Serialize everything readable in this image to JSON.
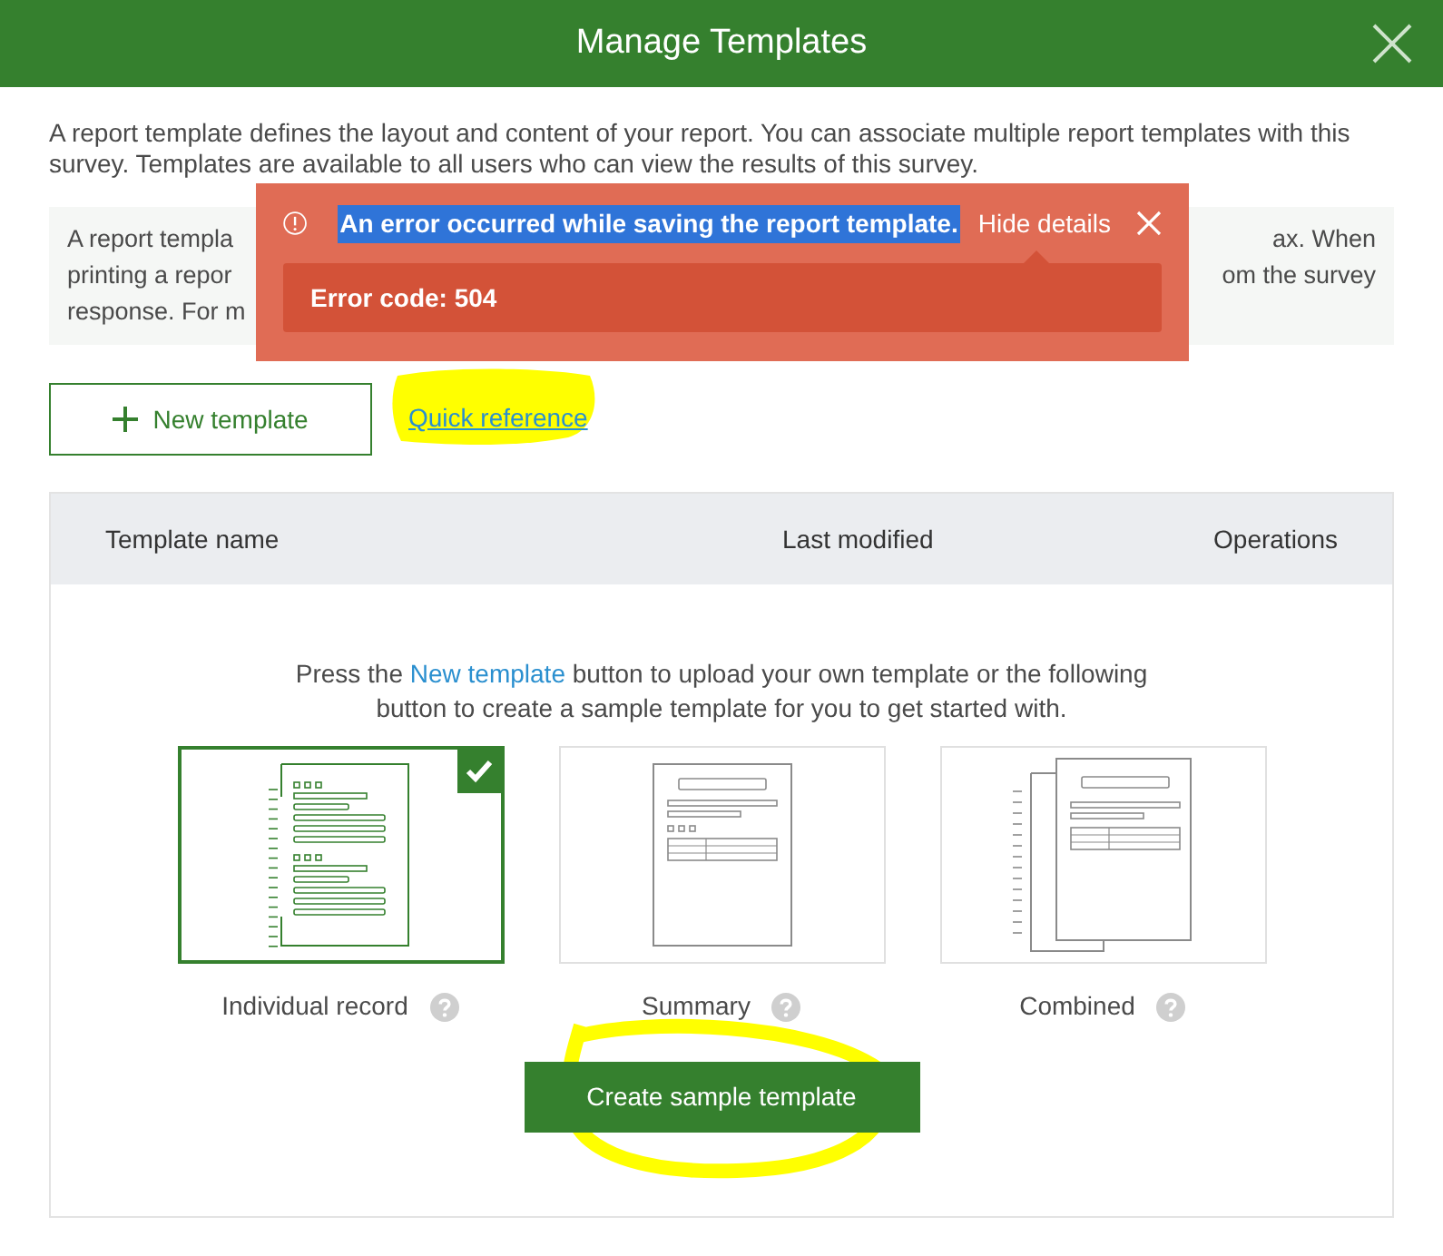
{
  "dialog": {
    "title": "Manage Templates"
  },
  "intro": "A report template defines the layout and content of your report. You can associate multiple report templates with this survey. Templates are available to all users who can view the results of this survey.",
  "info_box": {
    "lines": [
      {
        "left": "A report templa",
        "right": "ax. When"
      },
      {
        "left": "printing a repor",
        "right": "om the survey"
      },
      {
        "left": "response. For m"
      }
    ]
  },
  "error": {
    "message": "An error occurred while saving the report template.",
    "message_selected": true,
    "toggle": "Hide details",
    "details_expanded": true,
    "details": "Error code: 504"
  },
  "actions": {
    "new_button": "New template",
    "link": "Quick reference"
  },
  "table": {
    "columns": [
      "Template name",
      "Last modified",
      "Operations"
    ],
    "empty_text": {
      "before": "Press the ",
      "link": "New template",
      "after": " button to upload your own template or the following button to create a sample template for you to get started with."
    }
  },
  "samples": [
    {
      "kind": "individual",
      "label": "Individual record",
      "selected": true
    },
    {
      "kind": "summary",
      "label": "Summary",
      "selected": false
    },
    {
      "kind": "combined",
      "label": "Combined",
      "selected": false
    }
  ],
  "create_button": "Create sample template"
}
